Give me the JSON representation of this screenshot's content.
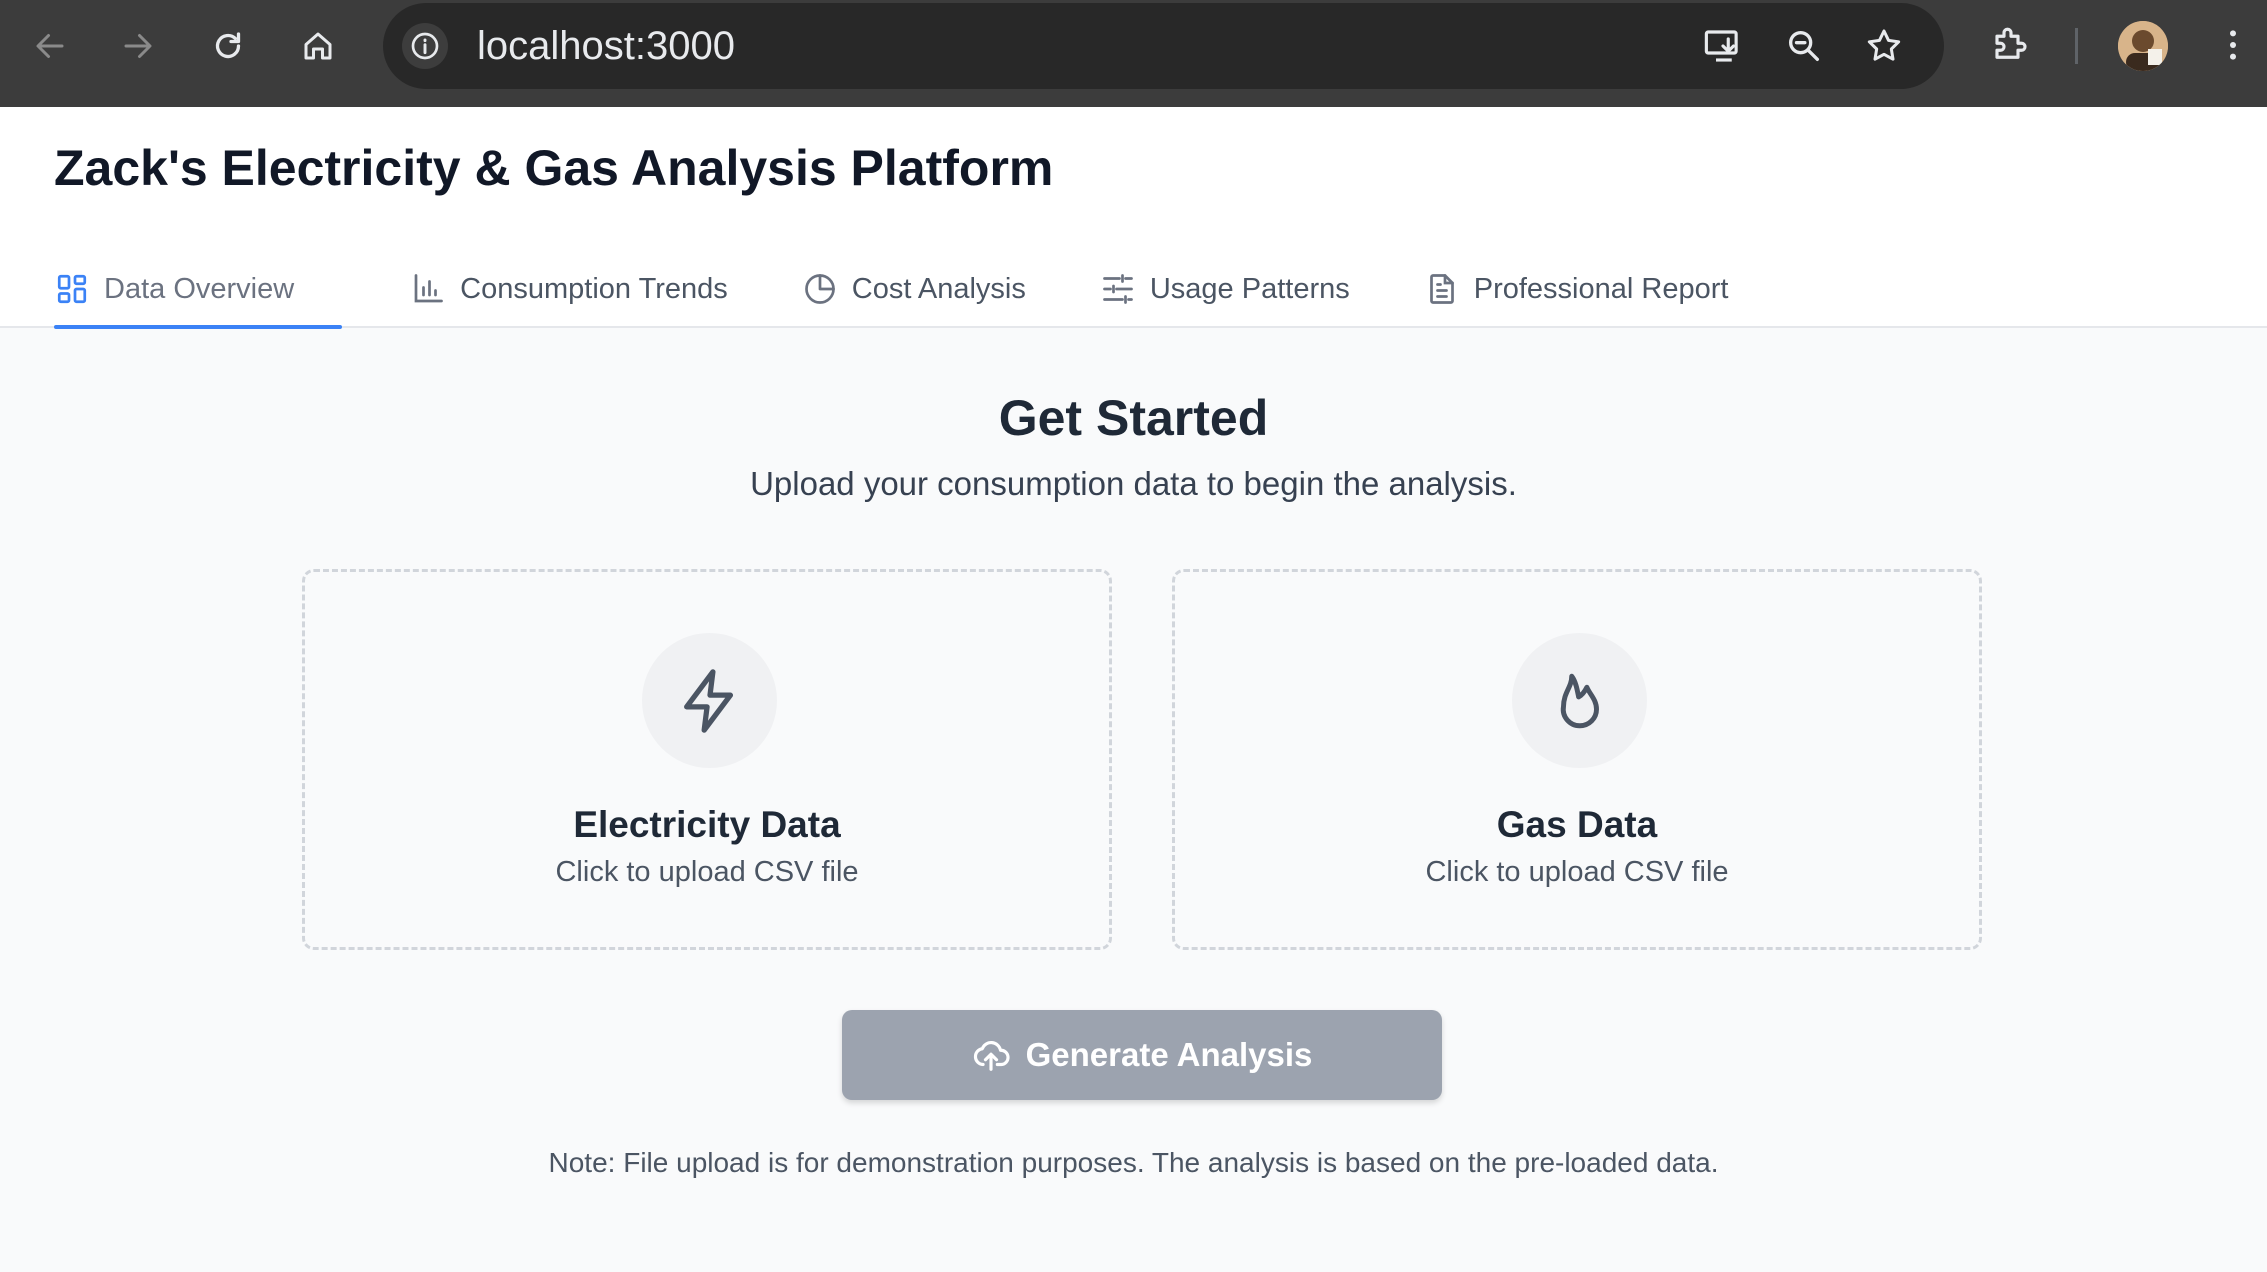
{
  "browser": {
    "url": "localhost:3000",
    "icons": {
      "back": "arrow-left-icon",
      "forward": "arrow-right-icon",
      "reload": "reload-icon",
      "home": "home-icon",
      "site_info": "info-icon",
      "install": "install-app-icon",
      "zoom": "zoom-icon",
      "bookmark": "star-icon",
      "extensions": "puzzle-icon",
      "menu": "more-vertical-icon"
    }
  },
  "header": {
    "title": "Zack's Electricity & Gas Analysis Platform"
  },
  "tabs": [
    {
      "label": "Data Overview",
      "icon": "grid-icon",
      "active": true
    },
    {
      "label": "Consumption Trends",
      "icon": "bar-chart-icon",
      "active": false
    },
    {
      "label": "Cost Analysis",
      "icon": "pie-chart-icon",
      "active": false
    },
    {
      "label": "Usage Patterns",
      "icon": "sliders-icon",
      "active": false
    },
    {
      "label": "Professional Report",
      "icon": "document-icon",
      "active": false
    }
  ],
  "main": {
    "heading": "Get Started",
    "subtitle": "Upload your consumption data to begin the analysis.",
    "cards": [
      {
        "title": "Electricity Data",
        "subtitle": "Click to upload CSV file",
        "icon": "lightning-icon"
      },
      {
        "title": "Gas Data",
        "subtitle": "Click to upload CSV file",
        "icon": "flame-icon"
      }
    ],
    "generate_button": {
      "label": "Generate Analysis",
      "icon": "cloud-upload-icon"
    },
    "note": "Note: File upload is for demonstration purposes. The analysis is based on the pre-loaded data."
  },
  "colors": {
    "accent": "#3b82f6",
    "button_disabled": "#9ca3af",
    "chrome_bg": "#3c3c3c",
    "omnibox_bg": "#282828"
  }
}
